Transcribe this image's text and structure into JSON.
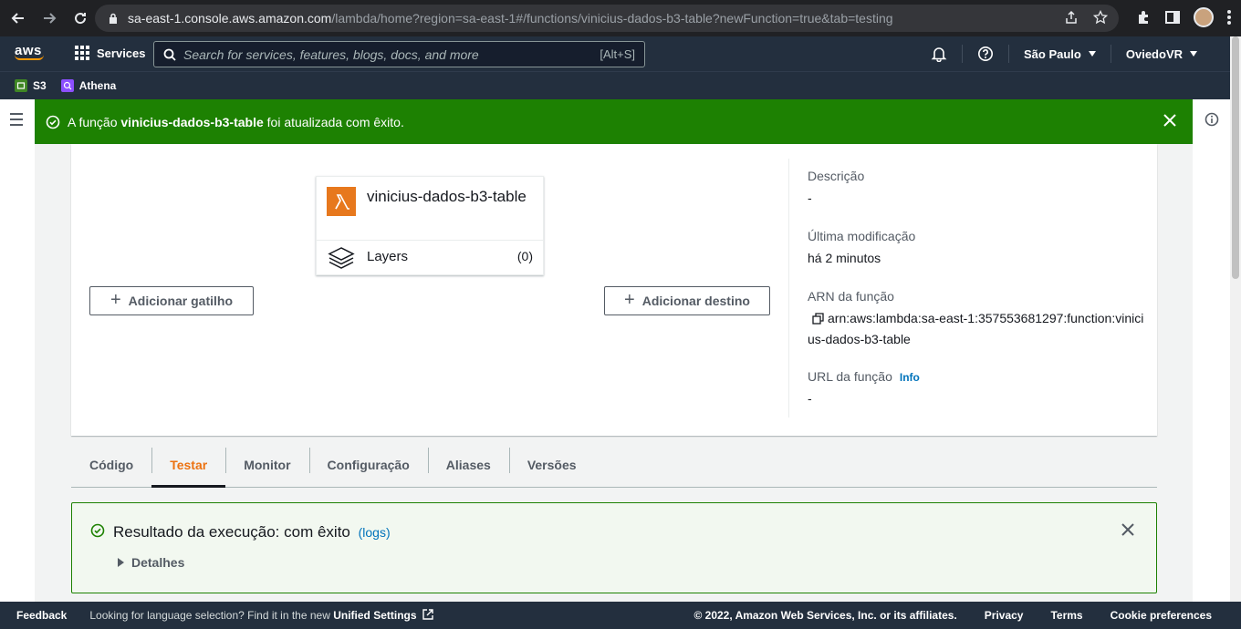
{
  "browser": {
    "url_host": "sa-east-1.console.aws.amazon.com",
    "url_path": "/lambda/home?region=sa-east-1#/functions/vinicius-dados-b3-table?newFunction=true&tab=testing"
  },
  "header": {
    "logo": "aws",
    "services_label": "Services",
    "search_placeholder": "Search for services, features, blogs, docs, and more",
    "search_shortcut": "[Alt+S]",
    "region": "São Paulo",
    "account": "OviedoVR"
  },
  "favorites": [
    {
      "label": "S3",
      "color": "#3f8624"
    },
    {
      "label": "Athena",
      "color": "#8c4fff"
    }
  ],
  "flash": {
    "prefix": "A função ",
    "function_name": "vinicius-dados-b3-table",
    "suffix": " foi atualizada com êxito."
  },
  "function_card": {
    "name": "vinicius-dados-b3-table",
    "layers_label": "Layers",
    "layers_count": "(0)"
  },
  "buttons": {
    "add_trigger": "Adicionar gatilho",
    "add_destination": "Adicionar destino"
  },
  "meta": {
    "description_label": "Descrição",
    "description_value": "-",
    "last_modified_label": "Última modificação",
    "last_modified_value": "há 2 minutos",
    "arn_label": "ARN da função",
    "arn_value": "arn:aws:lambda:sa-east-1:357553681297:function:vinicius-dados-b3-table",
    "url_label": "URL da função",
    "url_info": "Info",
    "url_value": "-"
  },
  "tabs": [
    {
      "label": "Código",
      "active": false
    },
    {
      "label": "Testar",
      "active": true
    },
    {
      "label": "Monitor",
      "active": false
    },
    {
      "label": "Configuração",
      "active": false
    },
    {
      "label": "Aliases",
      "active": false
    },
    {
      "label": "Versões",
      "active": false
    }
  ],
  "result": {
    "title": "Resultado da execução: com êxito",
    "logs_link": "(logs)",
    "details_label": "Detalhes"
  },
  "footer": {
    "feedback": "Feedback",
    "lang_text": "Looking for language selection? Find it in the new ",
    "lang_link": "Unified Settings",
    "copyright": "© 2022, Amazon Web Services, Inc. or its affiliates.",
    "privacy": "Privacy",
    "terms": "Terms",
    "cookies": "Cookie preferences"
  },
  "colors": {
    "success": "#1d8102",
    "aws_nav": "#232f3e",
    "accent_orange": "#ec7211",
    "link": "#0073bb"
  }
}
